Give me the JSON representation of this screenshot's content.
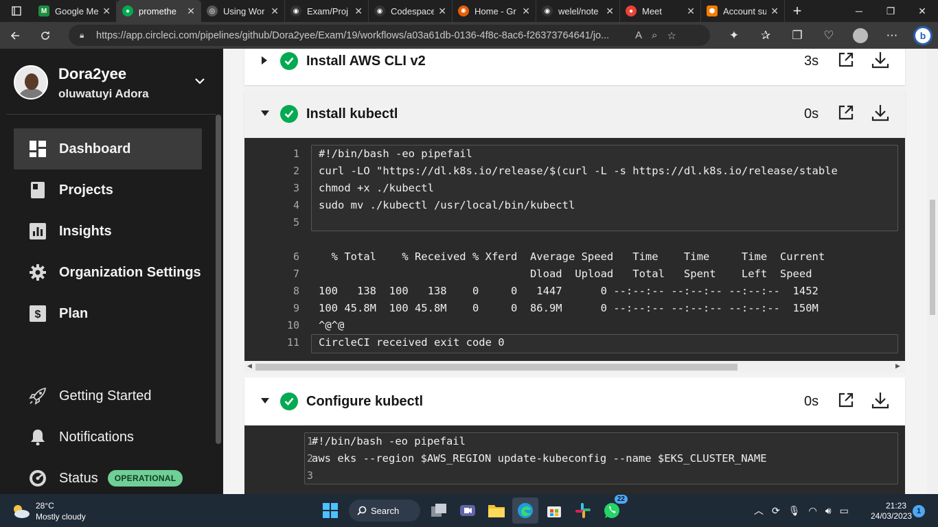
{
  "browser": {
    "tabs": [
      {
        "label": "Google Me",
        "color": "#1e8e3e",
        "active": false
      },
      {
        "label": "promethe",
        "color": "#04aa51",
        "active": true
      },
      {
        "label": "Using Wor",
        "color": "#555555",
        "active": false
      },
      {
        "label": "Exam/Proj",
        "color": "#333333",
        "active": false
      },
      {
        "label": "Codespace",
        "color": "#333333",
        "active": false
      },
      {
        "label": "Home - Gr",
        "color": "#e85d04",
        "active": false
      },
      {
        "label": "welel/note",
        "color": "#333333",
        "active": false
      },
      {
        "label": "Meet",
        "color": "#ea4335",
        "active": false
      },
      {
        "label": "Account su",
        "color": "#f57c00",
        "active": false
      }
    ],
    "url": "https://app.circleci.com/pipelines/github/Dora2yee/Exam/19/workflows/a03a61db-0136-4f8c-8ac6-f26373764641/jo..."
  },
  "sidebar": {
    "user_name": "Dora2yee",
    "user_sub": "oluwatuyi Adora",
    "items": [
      {
        "label": "Dashboard"
      },
      {
        "label": "Projects"
      },
      {
        "label": "Insights"
      },
      {
        "label": "Organization Settings"
      },
      {
        "label": "Plan"
      }
    ],
    "bottom_items": [
      {
        "label": "Getting Started"
      },
      {
        "label": "Notifications"
      },
      {
        "label": "Status"
      }
    ],
    "status_badge": "OPERATIONAL"
  },
  "steps": [
    {
      "title": "Install AWS CLI v2",
      "duration": "3s"
    },
    {
      "title": "Install kubectl",
      "duration": "0s"
    },
    {
      "title": "Configure kubectl",
      "duration": "0s"
    }
  ],
  "kubectl_log": [
    {
      "n": "1",
      "text": "#!/bin/bash -eo pipefail"
    },
    {
      "n": "2",
      "text": "curl -LO \"https://dl.k8s.io/release/$(curl -L -s https://dl.k8s.io/release/stable"
    },
    {
      "n": "3",
      "text": "chmod +x ./kubectl"
    },
    {
      "n": "4",
      "text": "sudo mv ./kubectl /usr/local/bin/kubectl"
    },
    {
      "n": "5",
      "text": ""
    },
    {
      "n": "6",
      "text": "  % Total    % Received % Xferd  Average Speed   Time    Time     Time  Current"
    },
    {
      "n": "7",
      "text": "                                 Dload  Upload   Total   Spent    Left  Speed"
    },
    {
      "n": "8",
      "text": "100   138  100   138    0     0   1447      0 --:--:-- --:--:-- --:--:--  1452"
    },
    {
      "n": "9",
      "text": "100 45.8M  100 45.8M    0     0  86.9M      0 --:--:-- --:--:-- --:--:--  150M"
    },
    {
      "n": "10",
      "text": "^@^@"
    },
    {
      "n": "11",
      "text": "CircleCI received exit code 0"
    }
  ],
  "configure_log": [
    {
      "n": "1",
      "text": "#!/bin/bash -eo pipefail"
    },
    {
      "n": "2",
      "text": "aws eks --region $AWS_REGION update-kubeconfig --name $EKS_CLUSTER_NAME"
    },
    {
      "n": "3",
      "text": ""
    }
  ],
  "taskbar": {
    "temperature": "28°C",
    "weather": "Mostly cloudy",
    "search_label": "Search",
    "whatsapp_badge": "22",
    "time": "21:23",
    "date": "24/03/2023",
    "notifications": "1"
  },
  "colors": {
    "success": "#04aa51",
    "sidebar_bg": "#1c1c1c",
    "console_bg": "#2a2a2a",
    "status_badge": "#6fcf97"
  }
}
